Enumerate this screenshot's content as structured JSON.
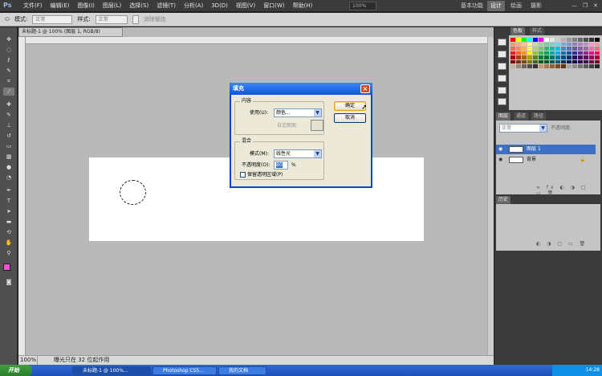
{
  "app": {
    "logo": "Ps"
  },
  "menu": [
    "文件(F)",
    "编辑(E)",
    "图像(I)",
    "图层(L)",
    "选择(S)",
    "滤镜(T)",
    "分析(A)",
    "3D(D)",
    "视图(V)",
    "窗口(W)",
    "帮助(H)"
  ],
  "menu_right": {
    "zoom": "100%",
    "workspace_basic": "基本功能",
    "workspace_design": "设计",
    "workspace_paint": "绘画",
    "workspace_more": "摄影"
  },
  "options": {
    "opacity_label": "模式:",
    "mode_value": "正常",
    "antialias_label": "样式:",
    "style_value": "正常",
    "checkbox_label": "消除锯齿"
  },
  "document": {
    "tab": "未标题-1 @ 100% (图层 1, RGB/8)",
    "zoom": "100%",
    "status": "曝光只在 32 位起作用"
  },
  "panels": {
    "swatches_tab": "色板",
    "styles_tab": "样式",
    "layers_tab": "图层",
    "channels_tab": "通道",
    "paths_tab": "路径",
    "blend_mode": "正常",
    "opacity": "不透明度:",
    "layers": [
      {
        "name": "图层 1",
        "selected": true
      },
      {
        "name": "背景",
        "selected": false
      }
    ],
    "history_tab": "历史"
  },
  "swatch_colors": [
    "#ff0000",
    "#ffff00",
    "#00ff00",
    "#00ffff",
    "#0000ff",
    "#ff00ff",
    "#ffffff",
    "#e6e6e6",
    "#cccccc",
    "#b3b3b3",
    "#999999",
    "#808080",
    "#666666",
    "#4d4d4d",
    "#333333",
    "#000000",
    "#f7977a",
    "#f9ad81",
    "#fdc68a",
    "#fff79a",
    "#c4df9b",
    "#a2d39c",
    "#82ca9d",
    "#7bcdc8",
    "#6ecff6",
    "#7ea7d8",
    "#8493ca",
    "#8882be",
    "#a187be",
    "#bc8dbf",
    "#f49ac2",
    "#f6989d",
    "#f26c4f",
    "#f68e55",
    "#fbaf5c",
    "#fff467",
    "#acd372",
    "#7cc576",
    "#3bb878",
    "#1abbb4",
    "#00bff3",
    "#438ccb",
    "#5574b9",
    "#605ca8",
    "#855fa8",
    "#a763a8",
    "#f06ea9",
    "#f26d7d",
    "#ed1c24",
    "#f26522",
    "#f7941d",
    "#fff200",
    "#8dc73f",
    "#39b54a",
    "#00a651",
    "#00a99d",
    "#00aeef",
    "#0072bc",
    "#0054a6",
    "#2e3192",
    "#662d91",
    "#92278f",
    "#ec008c",
    "#ed145b",
    "#9e0b0f",
    "#a0410d",
    "#a36209",
    "#aba000",
    "#598527",
    "#1a7b30",
    "#007236",
    "#00746b",
    "#0076a3",
    "#004b80",
    "#003471",
    "#1b1464",
    "#440e62",
    "#630460",
    "#9e005d",
    "#9e0039",
    "#790000",
    "#7b2e00",
    "#7d4900",
    "#827b00",
    "#406618",
    "#005e20",
    "#005826",
    "#005952",
    "#005b7f",
    "#003663",
    "#002157",
    "#0d004c",
    "#32004b",
    "#4b0049",
    "#7b0046",
    "#7a0026",
    "#c7b299",
    "#998675",
    "#736357",
    "#534741",
    "#37302d",
    "#c69c6d",
    "#a67c52",
    "#8c6239",
    "#754c24",
    "#603913",
    "#a6a6a6",
    "#8c8c8c",
    "#737373",
    "#595959",
    "#404040",
    "#262626"
  ],
  "dialog": {
    "title": "填充",
    "content_group": "内容",
    "use_label": "使用(U):",
    "use_value": "颜色...",
    "custom_pattern_label": "自定图案:",
    "blend_group": "混合",
    "mode_label": "模式(M):",
    "mode_value": "线性光",
    "opacity_label": "不透明度(O):",
    "opacity_value": "80",
    "opacity_unit": "%",
    "preserve_label": "保留透明区域(P)",
    "ok": "确定",
    "cancel": "取消"
  },
  "taskbar": {
    "start": "开始",
    "items": [
      "未标题-1 @ 100%...",
      "Photoshop CS5...",
      "我的文档"
    ],
    "clock": "14:28"
  }
}
